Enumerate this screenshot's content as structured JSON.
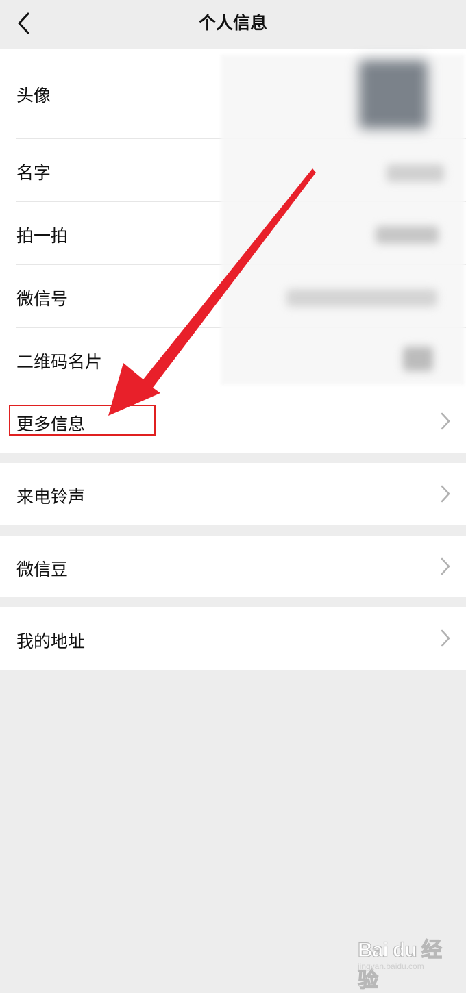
{
  "nav": {
    "title": "个人信息",
    "back_icon": "chevron-left-icon"
  },
  "profile_group": {
    "avatar_label": "头像",
    "name_label": "名字",
    "pat_label": "拍一拍",
    "wechat_id_label": "微信号",
    "qr_label": "二维码名片",
    "more_info_label": "更多信息"
  },
  "ringtone": {
    "label": "来电铃声"
  },
  "beans": {
    "label": "微信豆"
  },
  "address": {
    "label": "我的地址"
  },
  "annotation": {
    "color": "#e02020"
  },
  "watermark": {
    "brand": "Bai du 经验",
    "url": "jingyan.baidu.com"
  },
  "colors": {
    "background": "#ededed",
    "row_bg": "#ffffff",
    "accent": "#e02020"
  }
}
